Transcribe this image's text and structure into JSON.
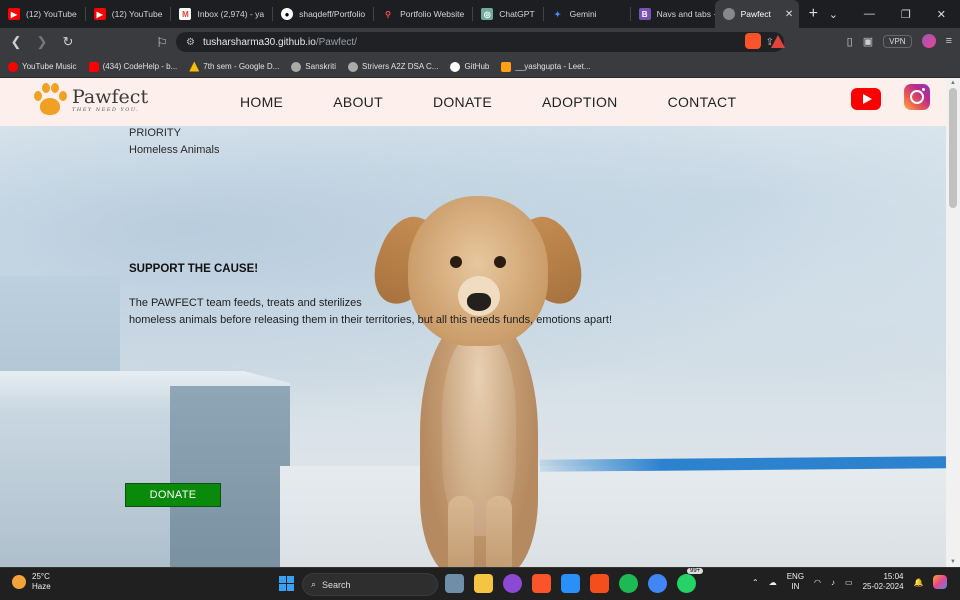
{
  "browser": {
    "tabs": [
      {
        "title": "(12) YouTube",
        "icon": "youtube-icon",
        "color": "#ff0000"
      },
      {
        "title": "(12) YouTube",
        "icon": "youtube-icon",
        "color": "#ff0000"
      },
      {
        "title": "Inbox (2,974) - ya",
        "icon": "gmail-icon",
        "color": "#ea4335"
      },
      {
        "title": "shaqdeff/Portfolio",
        "icon": "github-icon",
        "color": "#ffffff"
      },
      {
        "title": "Portfolio Website",
        "icon": "pin-icon",
        "color": "#ff4d4d"
      },
      {
        "title": "ChatGPT",
        "icon": "chatgpt-icon",
        "color": "#74aa9c"
      },
      {
        "title": "Gemini",
        "icon": "gemini-icon",
        "color": "#4e8cff"
      },
      {
        "title": "Navs and tabs · B",
        "icon": "bootstrap-icon",
        "color": "#7952b3"
      },
      {
        "title": "Pawfect",
        "icon": "globe-icon",
        "color": "#888888",
        "active": true
      }
    ],
    "url_host": "tusharsharma30.github.io",
    "url_path": "/Pawfect/",
    "vpn_label": "VPN",
    "bookmarks": [
      {
        "label": "YouTube Music",
        "icon": "youtube-music-icon",
        "color": "#ff0000"
      },
      {
        "label": "(434) CodeHelp - b...",
        "icon": "youtube-icon",
        "color": "#ff0000"
      },
      {
        "label": "7th sem - Google D...",
        "icon": "google-drive-icon",
        "color": "#fbbc04"
      },
      {
        "label": "Sanskriti",
        "icon": "globe-icon",
        "color": "#aaaaaa"
      },
      {
        "label": "Strivers A2Z DSA C...",
        "icon": "globe-icon",
        "color": "#aaaaaa"
      },
      {
        "label": "GitHub",
        "icon": "github-icon",
        "color": "#ffffff"
      },
      {
        "label": "__yashgupta - Leet...",
        "icon": "leetcode-icon",
        "color": "#ffa116"
      }
    ]
  },
  "site": {
    "logo_name": "Pawfect",
    "logo_tagline": "THEY NEED YOU.",
    "nav": [
      "HOME",
      "ABOUT",
      "DONATE",
      "ADOPTION",
      "CONTACT"
    ],
    "social": [
      "youtube-icon",
      "instagram-icon"
    ]
  },
  "hero": {
    "priority": "PRIORITY",
    "homeless": "Homeless Animals",
    "support": "SUPPORT THE CAUSE!",
    "desc_line1": "The PAWFECT team feeds, treats and sterilizes",
    "desc_line2": "homeless animals before releasing them in their territories, but all this needs funds, emotions apart!",
    "donate_label": "DONATE",
    "donate_color": "#0a8a0a"
  },
  "taskbar": {
    "temperature": "25°C",
    "weather": "Haze",
    "search_label": "Search",
    "lang_top": "ENG",
    "lang_bottom": "IN",
    "time": "15:04",
    "date": "25-02-2024",
    "badge_count": "99+"
  }
}
